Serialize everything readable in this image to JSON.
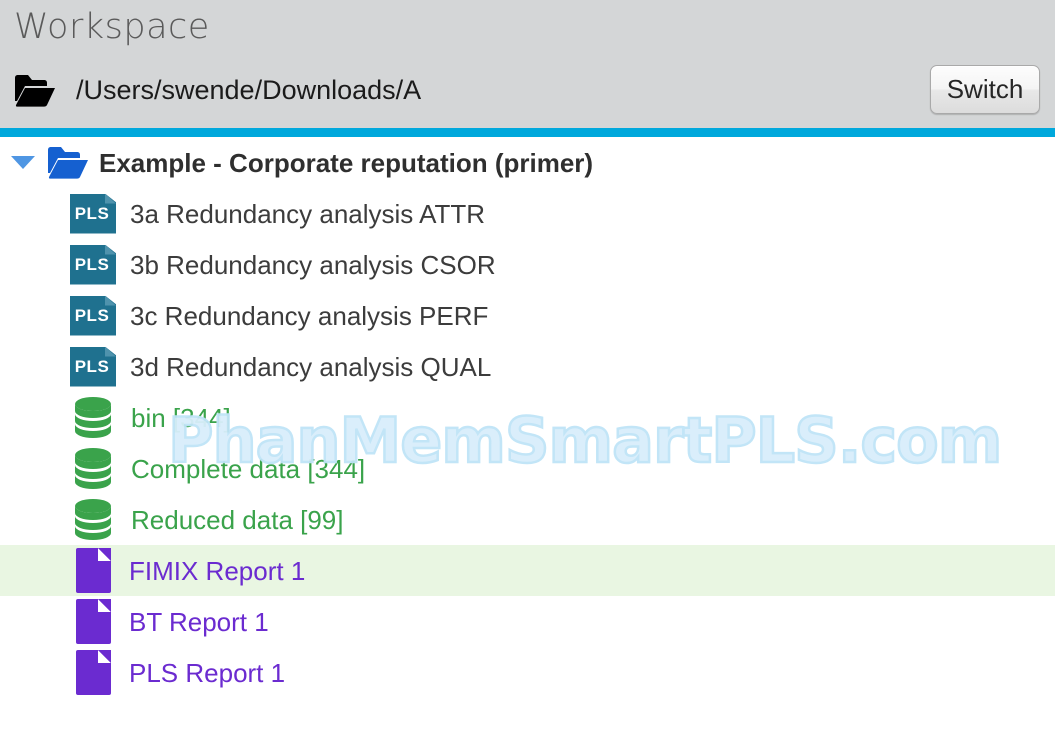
{
  "header": {
    "title": "Workspace",
    "folder_icon": "folder-open-icon",
    "path": "/Users/swende/Downloads/A",
    "switch_label": "Switch",
    "accent_color": "#00a8dc",
    "background_color": "#d4d6d7"
  },
  "tree": {
    "root": {
      "label": "Example - Corporate reputation (primer)",
      "icon": "folder-open-icon",
      "expanded": true,
      "disclosure_icon": "triangle-down-icon"
    },
    "items": [
      {
        "type": "pls",
        "icon_label": "PLS",
        "label": "3a Redundancy analysis ATTR",
        "selected": false
      },
      {
        "type": "pls",
        "icon_label": "PLS",
        "label": "3b Redundancy analysis CSOR",
        "selected": false
      },
      {
        "type": "pls",
        "icon_label": "PLS",
        "label": "3c Redundancy analysis PERF",
        "selected": false
      },
      {
        "type": "pls",
        "icon_label": "PLS",
        "label": "3d Redundancy analysis QUAL",
        "selected": false
      },
      {
        "type": "db",
        "icon_label": "",
        "label": "bin [344]",
        "selected": false
      },
      {
        "type": "db",
        "icon_label": "",
        "label": "Complete data [344]",
        "selected": false
      },
      {
        "type": "db",
        "icon_label": "",
        "label": "Reduced data [99]",
        "selected": false
      },
      {
        "type": "doc",
        "icon_label": "",
        "label": "FIMIX Report 1",
        "selected": true
      },
      {
        "type": "doc",
        "icon_label": "",
        "label": "BT Report 1",
        "selected": false
      },
      {
        "type": "doc",
        "icon_label": "",
        "label": "PLS Report 1",
        "selected": false
      }
    ],
    "colors": {
      "pls_icon": "#1f718f",
      "db_icon": "#3aa34b",
      "doc_icon": "#6b2bd0",
      "folder": "#1560d0",
      "selected_row": "#e9f6e2"
    }
  },
  "watermark": {
    "text": "PhanMemSmartPLS.com",
    "color": "#bfe4f7"
  }
}
